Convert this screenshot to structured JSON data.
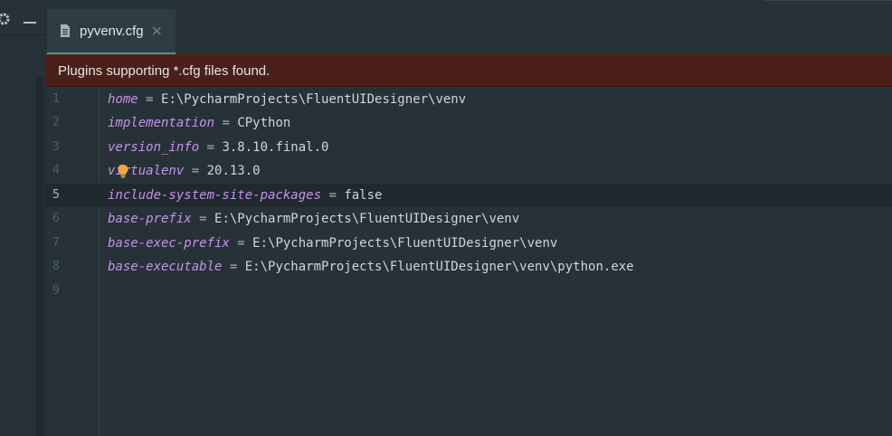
{
  "tool_window": {
    "settings_icon": "gear-icon",
    "minimize_icon": "minimize-icon"
  },
  "tabs": [
    {
      "label": "pyvenv.cfg",
      "icon": "config-file-icon",
      "close": "✕"
    }
  ],
  "banner": {
    "text": "Plugins supporting *.cfg files found."
  },
  "editor": {
    "current_line": 5,
    "lines": [
      {
        "number": "1",
        "key": "home",
        "eq": " = ",
        "value": "E:\\PycharmProjects\\FluentUIDesigner\\venv"
      },
      {
        "number": "2",
        "key": "implementation",
        "eq": " = ",
        "value": "CPython"
      },
      {
        "number": "3",
        "key": "version_info",
        "eq": " = ",
        "value": "3.8.10.final.0"
      },
      {
        "number": "4",
        "key": "virtualenv",
        "eq": " = ",
        "value": "20.13.0"
      },
      {
        "number": "5",
        "key": "include-system-site-packages",
        "eq": " = ",
        "value": "false"
      },
      {
        "number": "6",
        "key": "base-prefix",
        "eq": " = ",
        "value": "E:\\PycharmProjects\\FluentUIDesigner\\venv"
      },
      {
        "number": "7",
        "key": "base-exec-prefix",
        "eq": " = ",
        "value": "E:\\PycharmProjects\\FluentUIDesigner\\venv"
      },
      {
        "number": "8",
        "key": "base-executable",
        "eq": " = ",
        "value": "E:\\PycharmProjects\\FluentUIDesigner\\venv\\python.exe"
      },
      {
        "number": "9",
        "key": "",
        "eq": "",
        "value": ""
      }
    ],
    "intention_icon": "lightbulb-icon"
  },
  "colors": {
    "editor_bg": "#263238",
    "key": "#c792ea",
    "banner_bg": "#4a1f1a",
    "tab_accent": "#3f9c8f",
    "intention_bulb": "#f2a93b"
  }
}
